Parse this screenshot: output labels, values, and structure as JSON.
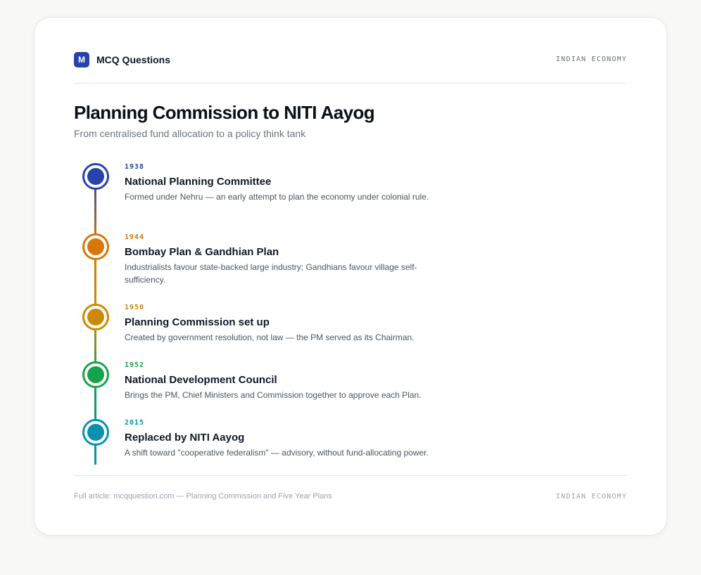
{
  "header": {
    "logo_letter": "M",
    "brand": "MCQ Questions",
    "tag": "INDIAN ECONOMY"
  },
  "title": "Planning Commission to NITI Aayog",
  "subtitle": "From centralised fund allocation to a policy think tank",
  "events": [
    {
      "year": "1938",
      "title": "National Planning Committee",
      "desc": "Formed under Nehru — an early attempt to plan the economy under colonial rule.",
      "color": "#2543a8"
    },
    {
      "year": "1944",
      "title": "Bombay Plan & Gandhian Plan",
      "desc": "Industrialists favour state-backed large industry; Gandhians favour village self-sufficiency.",
      "color": "#d97706"
    },
    {
      "year": "1950",
      "title": "Planning Commission set up",
      "desc": "Created by government resolution, not law — the PM served as its Chairman.",
      "color": "#ca8a04"
    },
    {
      "year": "1952",
      "title": "National Development Council",
      "desc": "Brings the PM, Chief Ministers and Commission together to approve each Plan.",
      "color": "#16a34a"
    },
    {
      "year": "2015",
      "title": "Replaced by NITI Aayog",
      "desc": "A shift toward \"cooperative federalism\" — advisory, without fund-allocating power.",
      "color": "#0891b2"
    }
  ],
  "footer": {
    "text": "Full article: mcqquestion.com — Planning Commission and Five Year Plans",
    "tag": "INDIAN ECONOMY"
  }
}
